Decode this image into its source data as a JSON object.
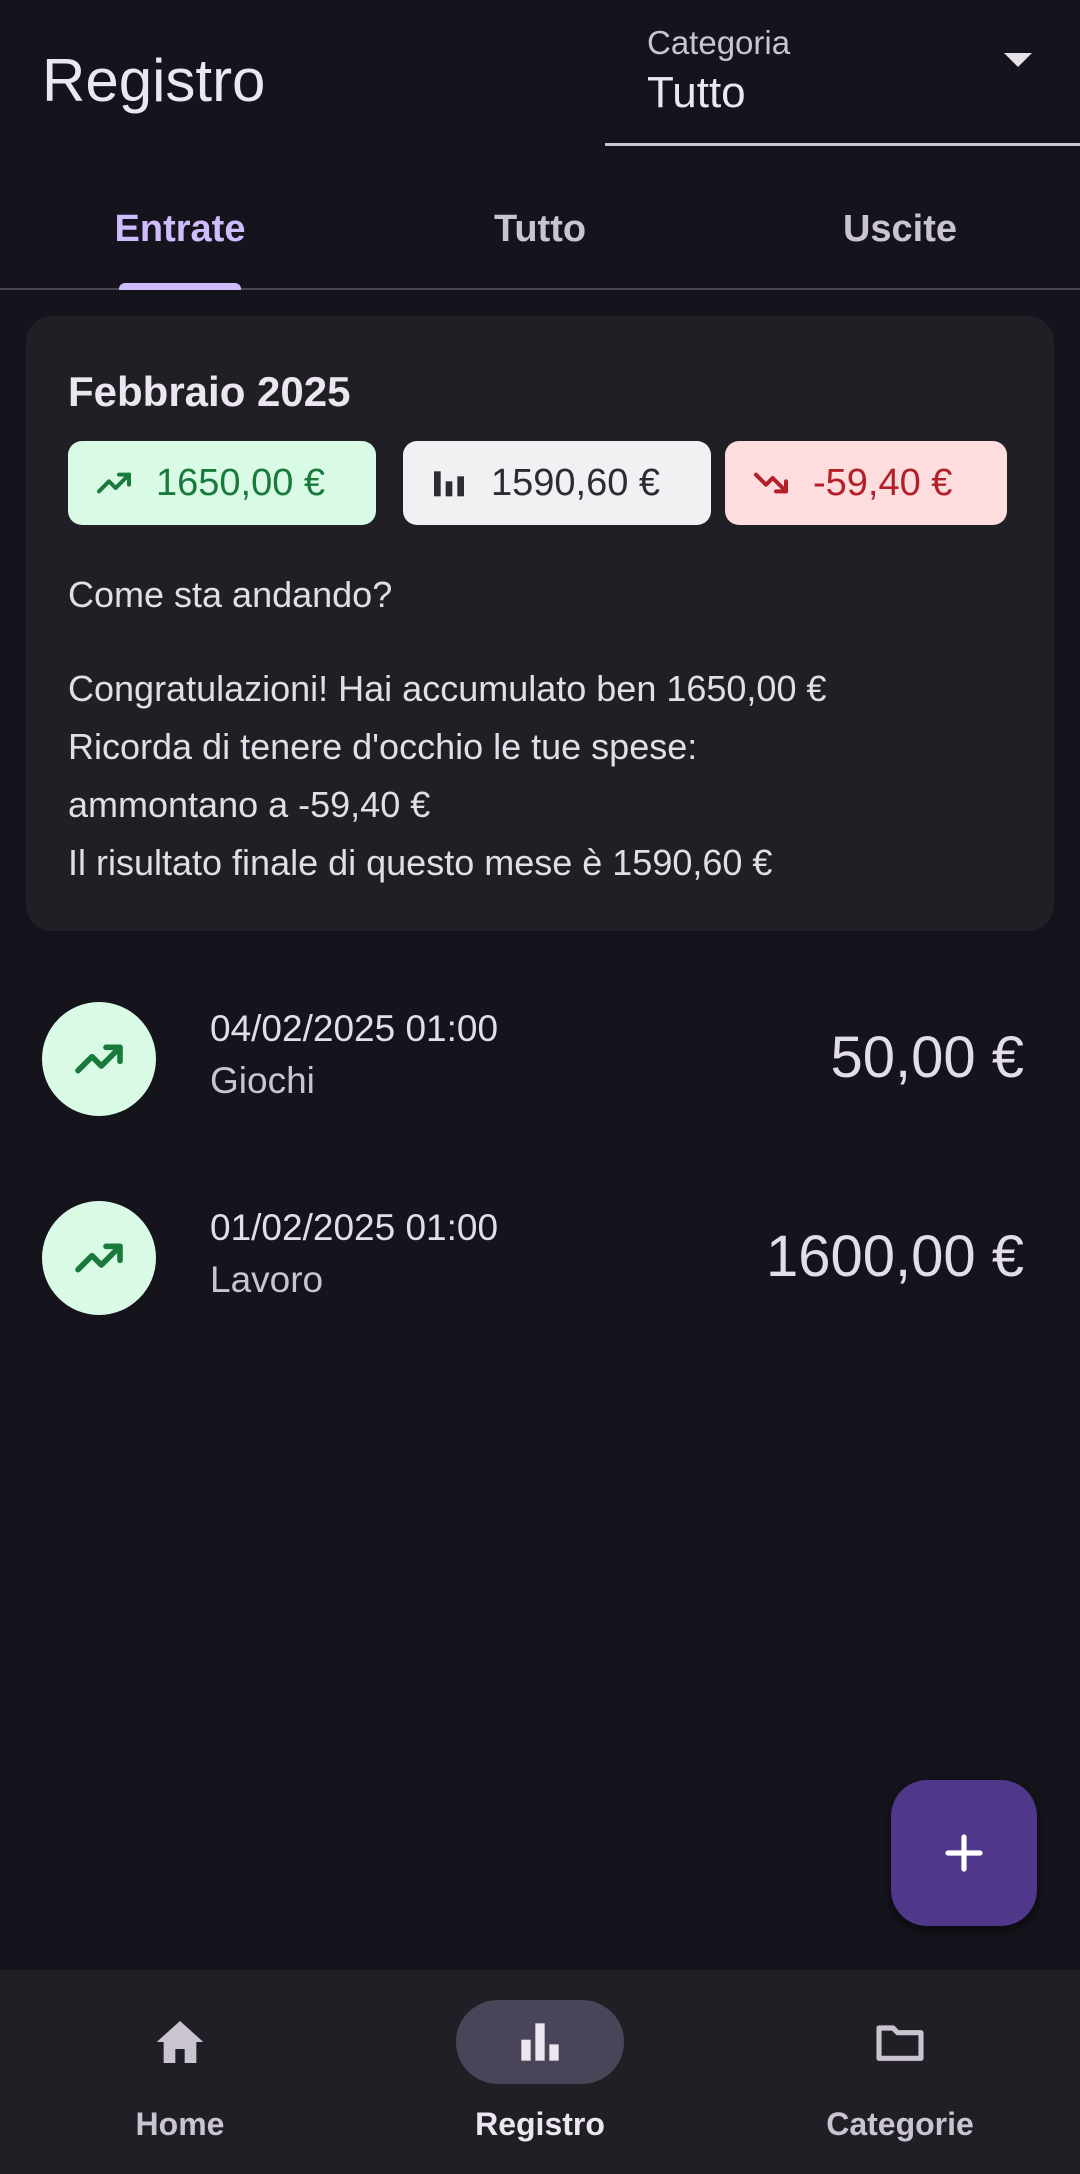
{
  "header": {
    "title": "Registro",
    "category_label": "Categoria",
    "category_value": "Tutto"
  },
  "tabs": [
    {
      "label": "Entrate",
      "active": true
    },
    {
      "label": "Tutto",
      "active": false
    },
    {
      "label": "Uscite",
      "active": false
    }
  ],
  "summary": {
    "month": "Febbraio 2025",
    "income": "1650,00 €",
    "balance": "1590,60 €",
    "expense": "-59,40 €",
    "question": "Come sta andando?",
    "lines": [
      "Congratulazioni! Hai accumulato ben 1650,00 €",
      "Ricorda di tenere d'occhio le tue spese:",
      "ammontano a -59,40 €",
      "Il risultato finale di questo mese è 1590,60 €"
    ]
  },
  "transactions": [
    {
      "datetime": "04/02/2025 01:00",
      "category": "Giochi",
      "amount": "50,00 €",
      "icon": "trending-up-icon"
    },
    {
      "datetime": "01/02/2025 01:00",
      "category": "Lavoro",
      "amount": "1600,00 €",
      "icon": "trending-up-icon"
    }
  ],
  "fab": {
    "icon": "plus-icon"
  },
  "bottom_nav": [
    {
      "label": "Home",
      "icon": "home-icon",
      "active": false
    },
    {
      "label": "Registro",
      "icon": "bar-chart-icon",
      "active": true
    },
    {
      "label": "Categorie",
      "icon": "folder-icon",
      "active": false
    }
  ],
  "colors": {
    "background": "#15131b",
    "card": "#211f26",
    "accent": "#cfbcff",
    "fab": "#4f378a",
    "income": "#1a7a3c",
    "expense": "#b3202a"
  }
}
